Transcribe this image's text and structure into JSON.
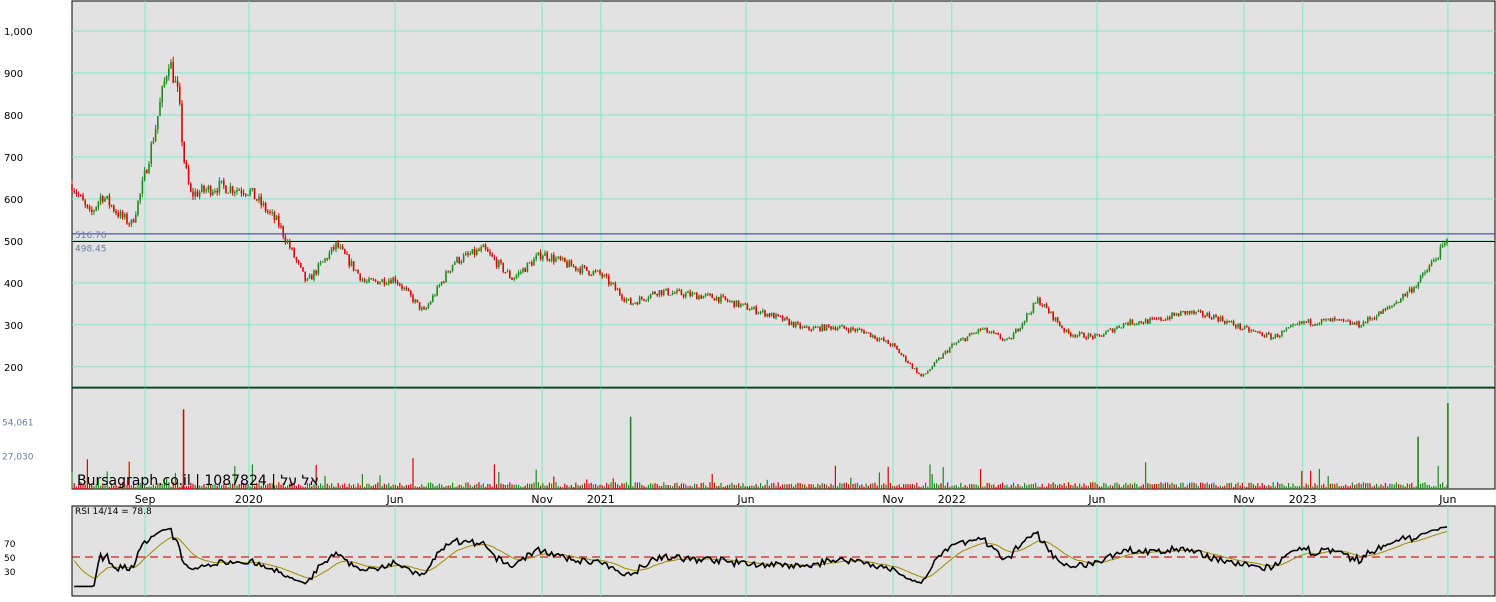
{
  "chart_data": [
    {
      "panel": "price",
      "type": "candlestick",
      "watermark": "Bursagraph.co.il | 1087824 | אל על",
      "y_ticks": [
        "1,000",
        "900",
        "800",
        "700",
        "600",
        "500",
        "400",
        "300",
        "200"
      ],
      "ylim": [
        150,
        1050
      ],
      "grid": true,
      "h_lines": [
        {
          "label": "516.76",
          "value": 516.76,
          "color": "#2b3a8f"
        },
        {
          "label": "498.45",
          "value": 498.45,
          "color": "#000000"
        }
      ],
      "colors": {
        "up": "#1a8c1a",
        "down": "#e00000",
        "background": "#e2e2e2",
        "grid": "#7fe8c4"
      },
      "closes_approx": [
        {
          "x": "2019-07",
          "y": 635
        },
        {
          "x": "2019-07-20",
          "y": 560
        },
        {
          "x": "2019-08",
          "y": 610
        },
        {
          "x": "2019-08-20",
          "y": 560
        },
        {
          "x": "2019-09",
          "y": 540
        },
        {
          "x": "2019-09-10",
          "y": 610
        },
        {
          "x": "2019-09-25",
          "y": 760
        },
        {
          "x": "2019-10-10",
          "y": 935
        },
        {
          "x": "2019-10-20",
          "y": 840
        },
        {
          "x": "2019-10-25",
          "y": 700
        },
        {
          "x": "2019-11",
          "y": 610
        },
        {
          "x": "2019-12",
          "y": 630
        },
        {
          "x": "2020-01",
          "y": 620
        },
        {
          "x": "2020-02",
          "y": 540
        },
        {
          "x": "2020-03",
          "y": 400
        },
        {
          "x": "2020-04",
          "y": 490
        },
        {
          "x": "2020-05",
          "y": 400
        },
        {
          "x": "2020-06",
          "y": 410
        },
        {
          "x": "2020-07",
          "y": 330
        },
        {
          "x": "2020-08",
          "y": 450
        },
        {
          "x": "2020-09",
          "y": 480
        },
        {
          "x": "2020-10",
          "y": 410
        },
        {
          "x": "2020-11",
          "y": 470
        },
        {
          "x": "2020-12",
          "y": 440
        },
        {
          "x": "2021-01",
          "y": 420
        },
        {
          "x": "2021-02",
          "y": 350
        },
        {
          "x": "2021-03",
          "y": 380
        },
        {
          "x": "2021-05",
          "y": 365
        },
        {
          "x": "2021-07",
          "y": 320
        },
        {
          "x": "2021-08",
          "y": 290
        },
        {
          "x": "2021-09",
          "y": 295
        },
        {
          "x": "2021-10",
          "y": 285
        },
        {
          "x": "2021-11",
          "y": 250
        },
        {
          "x": "2021-12",
          "y": 175
        },
        {
          "x": "2022-01",
          "y": 250
        },
        {
          "x": "2022-02",
          "y": 290
        },
        {
          "x": "2022-03",
          "y": 260
        },
        {
          "x": "2022-04",
          "y": 360
        },
        {
          "x": "2022-05",
          "y": 280
        },
        {
          "x": "2022-06",
          "y": 270
        },
        {
          "x": "2022-07",
          "y": 305
        },
        {
          "x": "2022-08",
          "y": 310
        },
        {
          "x": "2022-09",
          "y": 330
        },
        {
          "x": "2022-10",
          "y": 320
        },
        {
          "x": "2022-11",
          "y": 290
        },
        {
          "x": "2022-12",
          "y": 270
        },
        {
          "x": "2023-01",
          "y": 305
        },
        {
          "x": "2023-02",
          "y": 310
        },
        {
          "x": "2023-03",
          "y": 300
        },
        {
          "x": "2023-04",
          "y": 340
        },
        {
          "x": "2023-05",
          "y": 400
        },
        {
          "x": "2023-06",
          "y": 500
        }
      ]
    },
    {
      "panel": "volume",
      "type": "bar",
      "y_ticks": [
        "54,061",
        "27,030"
      ],
      "ylim": [
        0,
        81091
      ],
      "spikes_approx": [
        {
          "x": "2019-10-25",
          "y": 64000
        },
        {
          "x": "2021-02",
          "y": 58000
        },
        {
          "x": "2023-06",
          "y": 69000
        },
        {
          "x": "2023-05",
          "y": 42000
        }
      ]
    },
    {
      "panel": "rsi",
      "type": "line",
      "label": "RSI 14/14 = 78.8",
      "y_ticks": [
        "70",
        "50",
        "30"
      ],
      "ylim": [
        0,
        100
      ],
      "reference_line": 50,
      "colors": {
        "rsi": "#000000",
        "signal": "#a08a00",
        "reference": "#d02020"
      }
    }
  ],
  "x_axis": {
    "labels": [
      "Sep",
      "2020",
      "Jun",
      "Nov",
      "2021",
      "Jun",
      "Nov",
      "2022",
      "Jun",
      "Nov",
      "2023",
      "Jun"
    ]
  }
}
